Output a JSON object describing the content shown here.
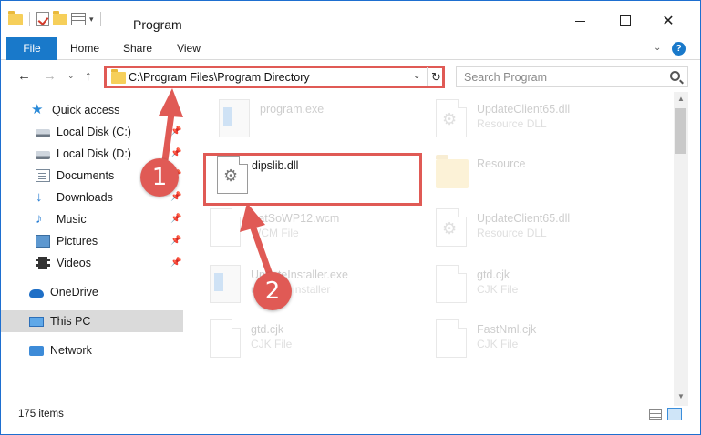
{
  "window": {
    "title": "Program",
    "qat_dropdown": "▾"
  },
  "ribbon": {
    "tabs": [
      "File",
      "Home",
      "Share",
      "View"
    ],
    "help": "?"
  },
  "address": {
    "path": "C:\\Program Files\\Program Directory",
    "refresh": "↻",
    "back": "←",
    "forward": "→",
    "recent": "⌄",
    "up": "↑"
  },
  "search": {
    "placeholder": "Search Program"
  },
  "sidebar": {
    "items": [
      {
        "label": "Quick access",
        "icon": "star-icon",
        "pinned": false
      },
      {
        "label": "Local Disk (C:)",
        "icon": "disk-icon",
        "pinned": true
      },
      {
        "label": "Local Disk (D:)",
        "icon": "disk-icon",
        "pinned": true
      },
      {
        "label": "Documents",
        "icon": "documents-icon",
        "pinned": true
      },
      {
        "label": "Downloads",
        "icon": "download-icon",
        "pinned": true
      },
      {
        "label": "Music",
        "icon": "music-icon",
        "pinned": true
      },
      {
        "label": "Pictures",
        "icon": "pictures-icon",
        "pinned": true
      },
      {
        "label": "Videos",
        "icon": "videos-icon",
        "pinned": true
      },
      {
        "label": "OneDrive",
        "icon": "cloud-icon",
        "pinned": false
      },
      {
        "label": "This PC",
        "icon": "pc-icon",
        "pinned": false,
        "selected": true
      },
      {
        "label": "Network",
        "icon": "network-icon",
        "pinned": false
      }
    ],
    "pin_glyph": "📌"
  },
  "files": [
    {
      "name": "program.exe",
      "type": "",
      "icon": "exe-icon",
      "faded": true
    },
    {
      "name": "UpdateClient65.dll",
      "type": "Resource DLL",
      "icon": "dll-gear-icon",
      "faded": true
    },
    {
      "name": "dipslib.dll",
      "type": "",
      "icon": "dll-gear-icon",
      "faded": false,
      "highlighted": true
    },
    {
      "name": "Resource",
      "type": "",
      "icon": "folder-icon",
      "faded": true
    },
    {
      "name": "BatSoWP12.wcm",
      "type": "WCM File",
      "icon": "file-icon",
      "faded": true
    },
    {
      "name": "UpdateClient65.dll",
      "type": "Resource DLL",
      "icon": "dll-gear-icon",
      "faded": true
    },
    {
      "name": "UpdateInstaller.exe",
      "type": "updates installer",
      "icon": "exe-icon",
      "faded": true
    },
    {
      "name": "gtd.cjk",
      "type": "CJK File",
      "icon": "file-icon",
      "faded": true
    },
    {
      "name": "gtd.cjk",
      "type": "CJK File",
      "icon": "file-icon",
      "faded": true
    },
    {
      "name": "FastNml.cjk",
      "type": "CJK File",
      "icon": "file-icon",
      "faded": true
    }
  ],
  "callouts": [
    "1",
    "2"
  ],
  "status": {
    "item_count": "175 items"
  },
  "colors": {
    "accent": "#1979ca",
    "annotation_red": "#e05a55"
  }
}
